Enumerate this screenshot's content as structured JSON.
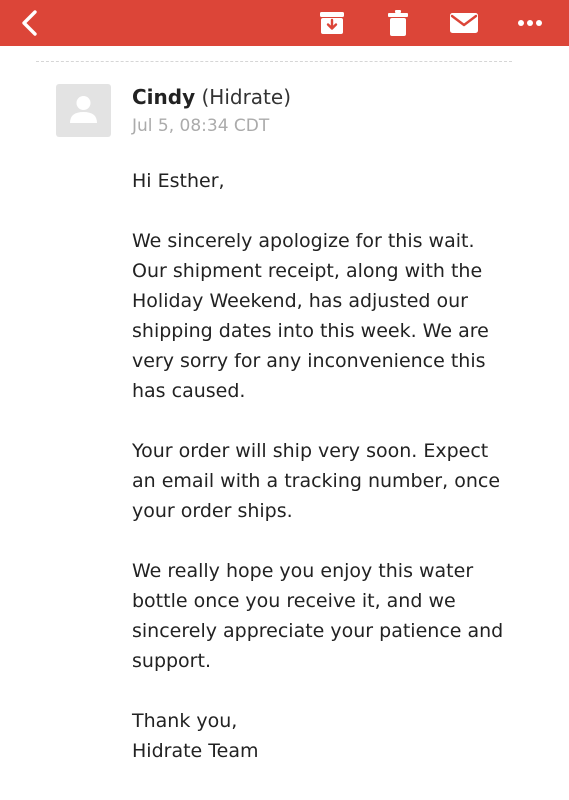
{
  "toolbar": {
    "color": "#dc4538",
    "icons": [
      "back-chevron",
      "archive-box",
      "trash-can",
      "envelope",
      "more-dots"
    ],
    "more_label": "•••"
  },
  "email": {
    "sender_name": "Cindy",
    "sender_org": "(Hidrate)",
    "timestamp": "Jul 5, 08:34 CDT",
    "greeting": "Hi Esther,",
    "paragraph_1": "We sincerely apologize for this wait.\nOur shipment receipt, along with the\nHoliday Weekend, has adjusted our\nshipping dates into this week. We are\nvery sorry for any inconvenience this\nhas caused.",
    "paragraph_2": "Your order will ship very soon. Expect\nan email with a tracking number, once\nyour order ships.",
    "paragraph_3": "We really hope you enjoy this water\nbottle once you receive it, and we\nsincerely appreciate your patience and\nsupport.",
    "closing": "Thank you,\nHidrate Team"
  }
}
